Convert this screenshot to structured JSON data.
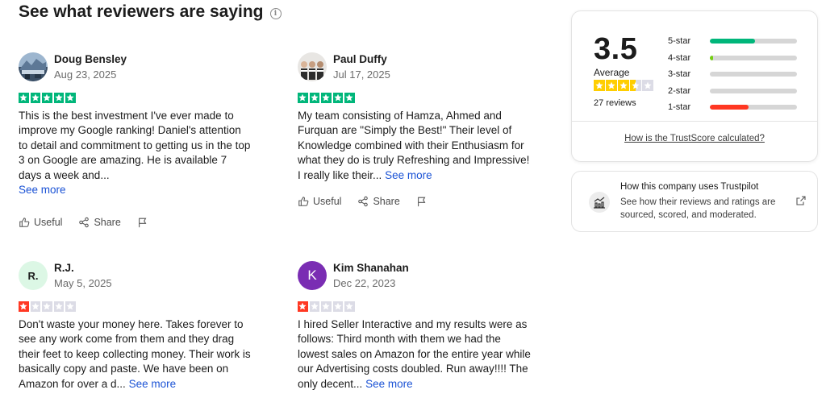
{
  "heading": "See what reviewers are saying",
  "info_icon": "info-icon",
  "colors": {
    "star_green": "#00b67a",
    "star_red": "#ff3722",
    "star_yellow": "#ffce00",
    "star_empty": "#dcdce6",
    "link_blue": "#1a52d5"
  },
  "actions": {
    "useful": "Useful",
    "share": "Share"
  },
  "see_more": "See more",
  "reviews": [
    {
      "name": "Doug Bensley",
      "date": "Aug 23, 2025",
      "rating": 5,
      "avatar": "photo",
      "text": "This is the best investment I've ever made to improve my Google ranking! Daniel's attention to detail and commitment to getting us in the top 3 on Google are amazing. He is available 7 days a week and...",
      "inline_more": false
    },
    {
      "name": "Paul Duffy",
      "date": "Jul 17, 2025",
      "rating": 5,
      "avatar": "photo",
      "text": "My team consisting of Hamza, Ahmed and Furquan are \"Simply the Best!\" Their level of Knowledge combined with their Enthusiasm for what they do is truly Refreshing and Impressive! I really like their...",
      "inline_more": true
    },
    {
      "name": "R.J.",
      "date": "May 5, 2025",
      "rating": 1,
      "avatar_initials": "R.",
      "avatar_bg": "#dcf7e5",
      "text": "Don't waste your money here. Takes forever to see any work come from them and they drag their feet to keep collecting money. Their work is basically copy and paste. We have been on Amazon for over a d...",
      "inline_more": true
    },
    {
      "name": "Kim Shanahan",
      "date": "Dec 22, 2023",
      "rating": 1,
      "avatar_initials": "K",
      "avatar_bg": "#7a2db3",
      "text": "I hired Seller Interactive and my results were as follows: Third month with them we had the lowest sales on Amazon for the entire year while our Advertising costs doubled. Run away!!!! The only decent...",
      "inline_more": true
    }
  ],
  "score": {
    "value": "3.5",
    "average_label": "Average",
    "stars_rating": 3.5,
    "reviews_count": "27 reviews",
    "distribution": [
      {
        "label": "5-star",
        "fraction": 0.52,
        "color": "#00b67a"
      },
      {
        "label": "4-star",
        "fraction": 0.04,
        "color": "#73cf11"
      },
      {
        "label": "3-star",
        "fraction": 0,
        "color": "#d6d6d6"
      },
      {
        "label": "2-star",
        "fraction": 0,
        "color": "#d6d6d6"
      },
      {
        "label": "1-star",
        "fraction": 0.44,
        "color": "#ff3722"
      }
    ],
    "calc_link": "How is the TrustScore calculated?"
  },
  "company_uses": {
    "title": "How this company uses Trustpilot",
    "description": "See how their reviews and ratings are sourced, scored, and moderated.",
    "icon": "bar-chart-icon",
    "link_icon": "external-link-icon"
  }
}
